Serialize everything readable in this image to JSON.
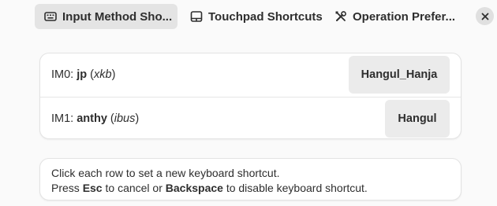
{
  "tabs": [
    {
      "label": "Input Method Sho...",
      "icon": "keyboard-icon",
      "active": true
    },
    {
      "label": "Touchpad Shortcuts",
      "icon": "touchpad-icon",
      "active": false
    },
    {
      "label": "Operation Prefer...",
      "icon": "tools-icon",
      "active": false
    }
  ],
  "close_icon": "close-icon",
  "rows": [
    {
      "prefix": "IM0: ",
      "name": "jp",
      "open": " (",
      "backend": "xkb",
      "close": ")",
      "shortcut": "Hangul_Hanja"
    },
    {
      "prefix": "IM1: ",
      "name": "anthy",
      "open": " (",
      "backend": "ibus",
      "close": ")",
      "shortcut": "Hangul"
    }
  ],
  "info": {
    "line1": "Click each row to set a new keyboard shortcut.",
    "line2_a": "Press ",
    "line2_esc": "Esc",
    "line2_b": " to cancel or ",
    "line2_backspace": "Backspace",
    "line2_c": " to disable keyboard shortcut."
  },
  "colors": {
    "background": "#fafafa",
    "active_tab": "#e4e4e4",
    "card": "#ffffff",
    "shortcut_button": "#ebebeb"
  }
}
